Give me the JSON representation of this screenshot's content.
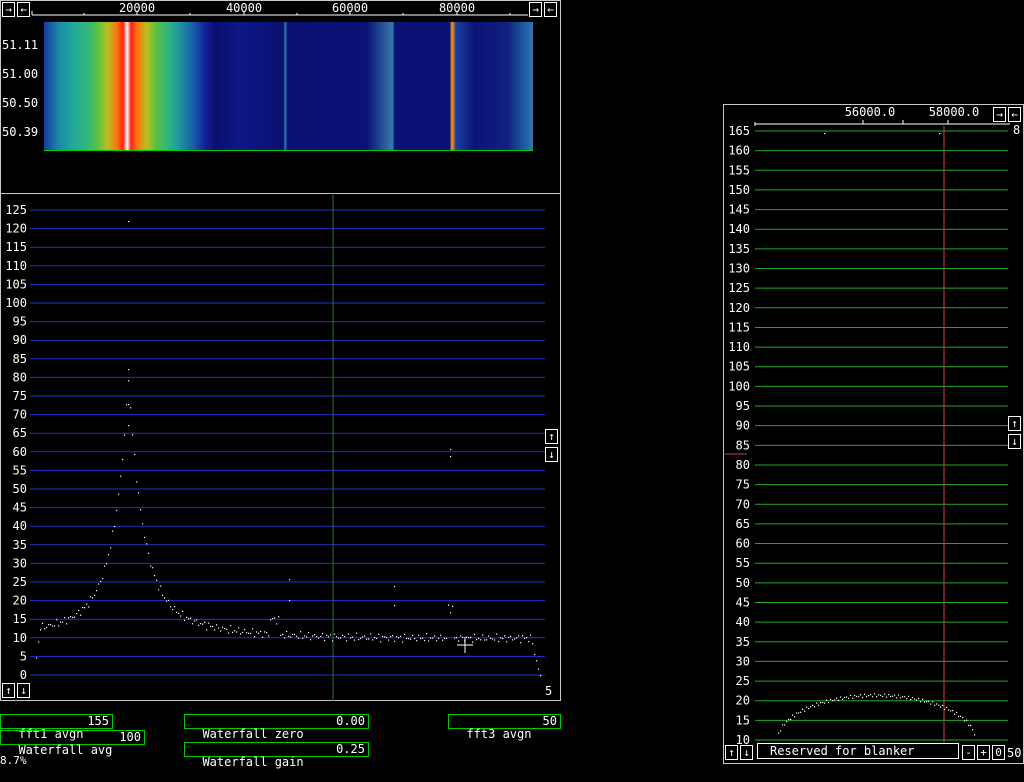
{
  "top_panel": {
    "freq_labels": [
      "20000",
      "40000",
      "60000",
      "80000"
    ],
    "waterfall_times": [
      "51.11",
      "51.00",
      "50.50",
      "50.39"
    ]
  },
  "spectrum": {
    "y_labels": [
      "125",
      "120",
      "115",
      "110",
      "105",
      "100",
      "95",
      "90",
      "85",
      "80",
      "75",
      "70",
      "65",
      "60",
      "55",
      "50",
      "45",
      "40",
      "35",
      "30",
      "25",
      "20",
      "15",
      "10",
      "5",
      "0"
    ],
    "avg_count": "5"
  },
  "params": {
    "fft1_avgn_label": "fft1 avgn",
    "fft1_avgn_value": "155",
    "waterfall_avg_label": "Waterfall avg",
    "waterfall_avg_value": "100",
    "waterfall_zero_label": "Waterfall zero",
    "waterfall_zero_value": "0.00",
    "waterfall_gain_label": "Waterfall gain",
    "waterfall_gain_value": "0.25",
    "fft3_avgn_label": "fft3 avgn",
    "fft3_avgn_value": "50"
  },
  "cpu_load": "8.7%",
  "right_panel": {
    "freq_labels": [
      "56000.0",
      "58000.0"
    ],
    "y_labels": [
      "165",
      "160",
      "155",
      "150",
      "145",
      "140",
      "135",
      "130",
      "125",
      "120",
      "115",
      "110",
      "105",
      "100",
      "95",
      "90",
      "85",
      "80",
      "75",
      "70",
      "65",
      "60",
      "55",
      "50",
      "45",
      "40",
      "35",
      "30",
      "25",
      "20",
      "15",
      "10"
    ],
    "corner_value": "8",
    "blanker_label": "Reserved for blanker",
    "blanker_value": "50"
  },
  "icons": {
    "scroll_right": "→",
    "scroll_left": "←",
    "arrow_up": "↑",
    "arrow_down": "↓",
    "minus": "-",
    "plus": "+",
    "zero": "0"
  },
  "colors": {
    "grid_blue": "#2233cc",
    "grid_green": "#22aa22",
    "marker_red": "#cc4444",
    "box_green": "#00cc00"
  }
}
